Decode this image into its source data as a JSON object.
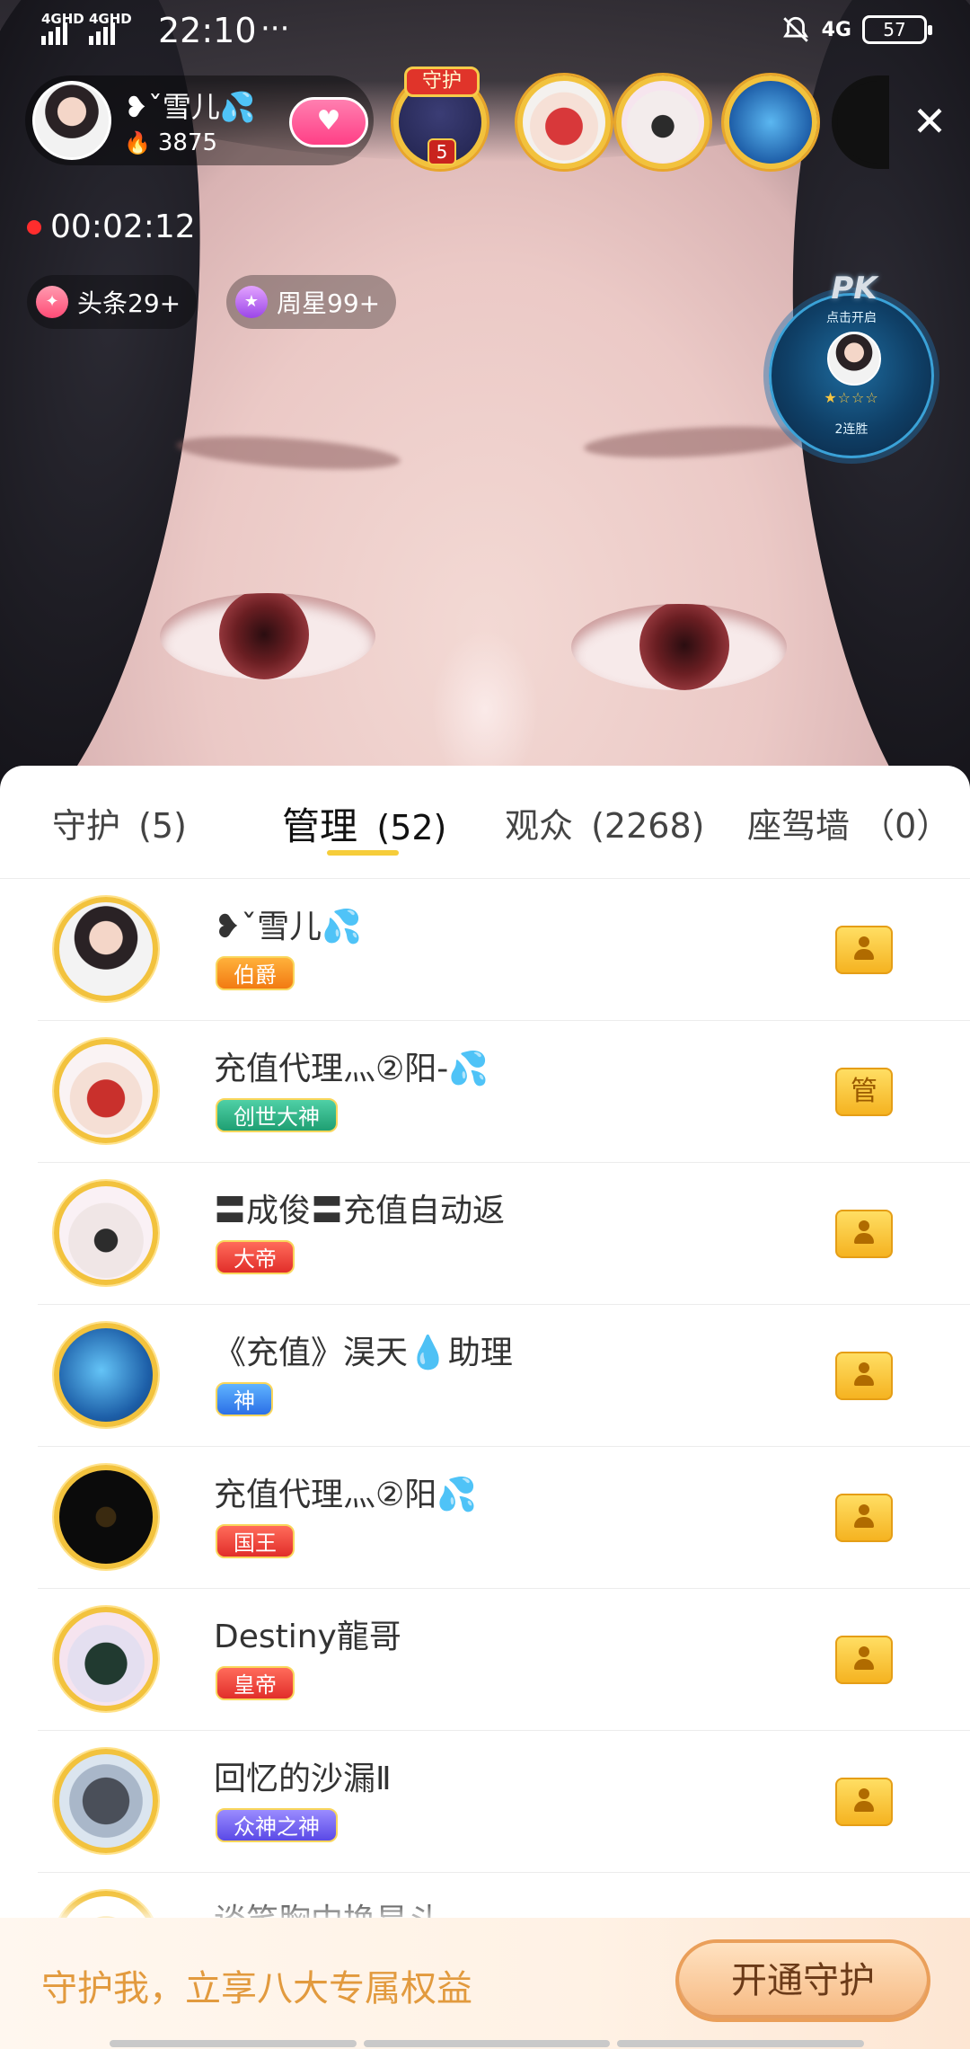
{
  "status_bar": {
    "network1": "4GHD",
    "network2": "4GHD",
    "time": "22:10",
    "dots": "···",
    "right_network": "4G",
    "battery": "57"
  },
  "host": {
    "name": "❥ˇ雪儿💦",
    "hot": "3875"
  },
  "guardian_tag": "守护",
  "guardian_count": "5",
  "live_timer": "00:02:12",
  "chips": {
    "headline": "头条29+",
    "weekstar": "周星99+"
  },
  "pk": {
    "logo": "PK",
    "hint": "点击开启",
    "stars": "★☆☆☆",
    "streak": "2连胜"
  },
  "tabs": [
    {
      "label": "守护",
      "count": "(5)"
    },
    {
      "label": "管理",
      "count": "(52)"
    },
    {
      "label": "观众",
      "count": "(2268)"
    },
    {
      "label": "座驾墙",
      "count": "（0）"
    }
  ],
  "members": [
    {
      "name": "❥ˇ雪儿💦",
      "badge": "伯爵",
      "role": "person"
    },
    {
      "name": "充值代理灬②阳-💦",
      "badge": "创世大神",
      "role": "管"
    },
    {
      "name": "〓成俊〓充值自动返",
      "badge": "大帝",
      "role": "person"
    },
    {
      "name": "《充值》淏天💧助理",
      "badge": "神",
      "role": "person"
    },
    {
      "name": "充值代理灬②阳💦",
      "badge": "国王",
      "role": "person"
    },
    {
      "name": "Destiny龍哥",
      "badge": "皇帝",
      "role": "person"
    },
    {
      "name": "回忆的沙漏Ⅱ",
      "badge": "众神之神",
      "role": "person"
    },
    {
      "name": "谈笑胸中换星斗",
      "badge": "",
      "role": ""
    }
  ],
  "promo": {
    "text": "守护我，立享八大专属权益",
    "button": "开通守护"
  },
  "colors": {
    "accent_yellow": "#f6cd3a",
    "promo_text": "#e29a3e",
    "promo_button": "#f6b880"
  }
}
